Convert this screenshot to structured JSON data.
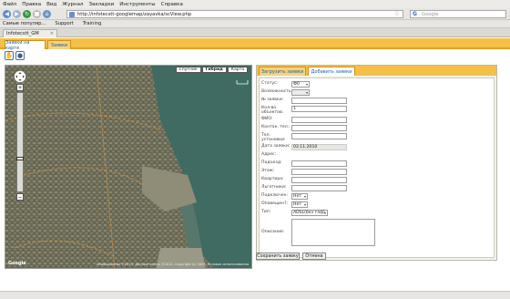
{
  "menu": [
    "Файл",
    "Правка",
    "Вид",
    "Журнал",
    "Закладки",
    "Инструменты",
    "Справка"
  ],
  "nav": {
    "url": "http://infotecstt-googlemap/zayavka/scView.php",
    "search_placeholder": "Google"
  },
  "bookmarks": [
    "Самые популяр...",
    "Support",
    "Training"
  ],
  "browser_tab": "Infotecstt_GM",
  "app_tabs": [
    "Заявки на карте",
    "Заявки"
  ],
  "tools": [
    "hand-icon",
    "marker-icon"
  ],
  "map": {
    "types": [
      "Спутник",
      "Гибрид",
      "Карта"
    ],
    "active_type": "Гибрид",
    "logo": "Google",
    "copyright": "Изображения ©2010. Данные карты ©2010. Copyright (c) 2009. Условия использования"
  },
  "panel": {
    "tabs": [
      "Загрузить заявки",
      "Добавить заявки"
    ],
    "fields": [
      {
        "label": "Статус:",
        "value": "Ф0",
        "type": "select"
      },
      {
        "label": "Возможность:",
        "value": "",
        "type": "select"
      },
      {
        "label": "№ заявки:",
        "value": "",
        "type": "text"
      },
      {
        "label": "Кол-во объектов:",
        "value": "1",
        "type": "text"
      },
      {
        "label": "ФИО:",
        "value": "",
        "type": "text"
      },
      {
        "label": "Контак. тел.:",
        "value": "",
        "type": "text"
      },
      {
        "label": "Тел. установки:",
        "value": "",
        "type": "text"
      },
      {
        "label": "Дата заявки:",
        "value": "03.11.2010",
        "type": "readonly"
      },
      {
        "label": "Адрес:",
        "value": "",
        "type": "none"
      },
      {
        "label": "Подъезд:",
        "value": "",
        "type": "text"
      },
      {
        "label": "Этаж:",
        "value": "",
        "type": "text"
      },
      {
        "label": "Квартира:",
        "value": "",
        "type": "text"
      },
      {
        "label": "Льготники:",
        "value": "",
        "type": "text"
      },
      {
        "label": "Подключен:",
        "value": "Нет",
        "type": "select"
      },
      {
        "label": "Оповещен?:",
        "value": "Нет",
        "type": "select"
      },
      {
        "label": "Тип:",
        "value": "ADSL(без тлф)",
        "type": "select"
      },
      {
        "label": "Описание:",
        "value": "",
        "type": "textarea"
      }
    ],
    "save_button": "Сохранить заявку",
    "cancel_button": "Отмена"
  },
  "colors": {
    "accent": "#f4c048",
    "accent_dark": "#e8a21a",
    "link": "#1f5eaa"
  }
}
